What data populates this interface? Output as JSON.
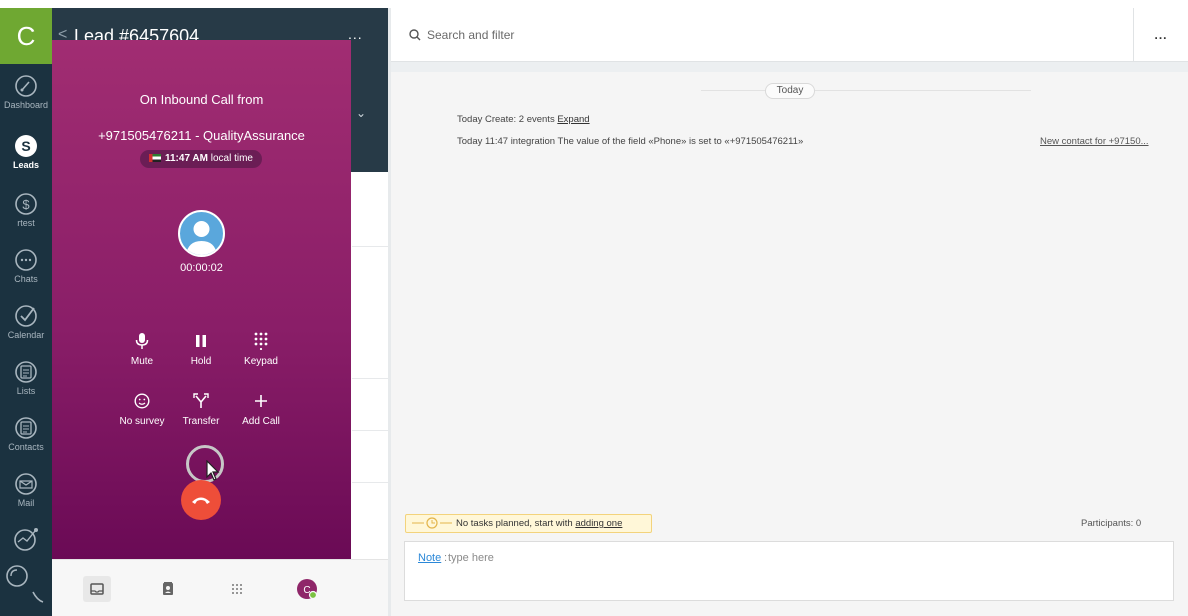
{
  "nav": {
    "logo": "C",
    "items": [
      {
        "label": "Dashboard",
        "icon": "dashboard-icon"
      },
      {
        "label": "Leads",
        "icon": "leads-icon"
      },
      {
        "label": "rtest",
        "icon": "dollar-icon"
      },
      {
        "label": "Chats",
        "icon": "chat-icon"
      },
      {
        "label": "Calendar",
        "icon": "check-icon"
      },
      {
        "label": "Lists",
        "icon": "list-icon"
      },
      {
        "label": "Contacts",
        "icon": "contacts-icon"
      },
      {
        "label": "Mail",
        "icon": "mail-icon"
      }
    ]
  },
  "lead": {
    "back": "<",
    "title": "Lead #6457604",
    "more": "..."
  },
  "call": {
    "heading": "On Inbound Call from",
    "caller": "+971505476211 - QualityAssurance",
    "local_time": "11:47 AM",
    "local_time_suffix": "local time",
    "duration": "00:00:02",
    "controls": {
      "mute": "Mute",
      "hold": "Hold",
      "keypad": "Keypad",
      "survey": "No survey",
      "transfer": "Transfer",
      "add_call": "Add Call"
    }
  },
  "right": {
    "search_placeholder": "Search and filter",
    "more": "...",
    "today_pill": "Today",
    "events_line_prefix": "Today Create: 2 events ",
    "expand": "Expand",
    "integration_line": "Today 11:47 integration The value of the field «Phone» is set to «+971505476211»",
    "new_contact": "New contact for +97150...",
    "tasks_text": "No tasks planned, start with ",
    "tasks_link": "adding one",
    "participants": "Participants: 0",
    "note_label": "Note",
    "note_placeholder": "type here"
  },
  "colors": {
    "nav_bg": "#1b3240",
    "logo_bg": "#6fa832",
    "call_gradient_top": "#a12d72",
    "call_gradient_bottom": "#6a0a55",
    "hangup": "#ee4e39"
  }
}
